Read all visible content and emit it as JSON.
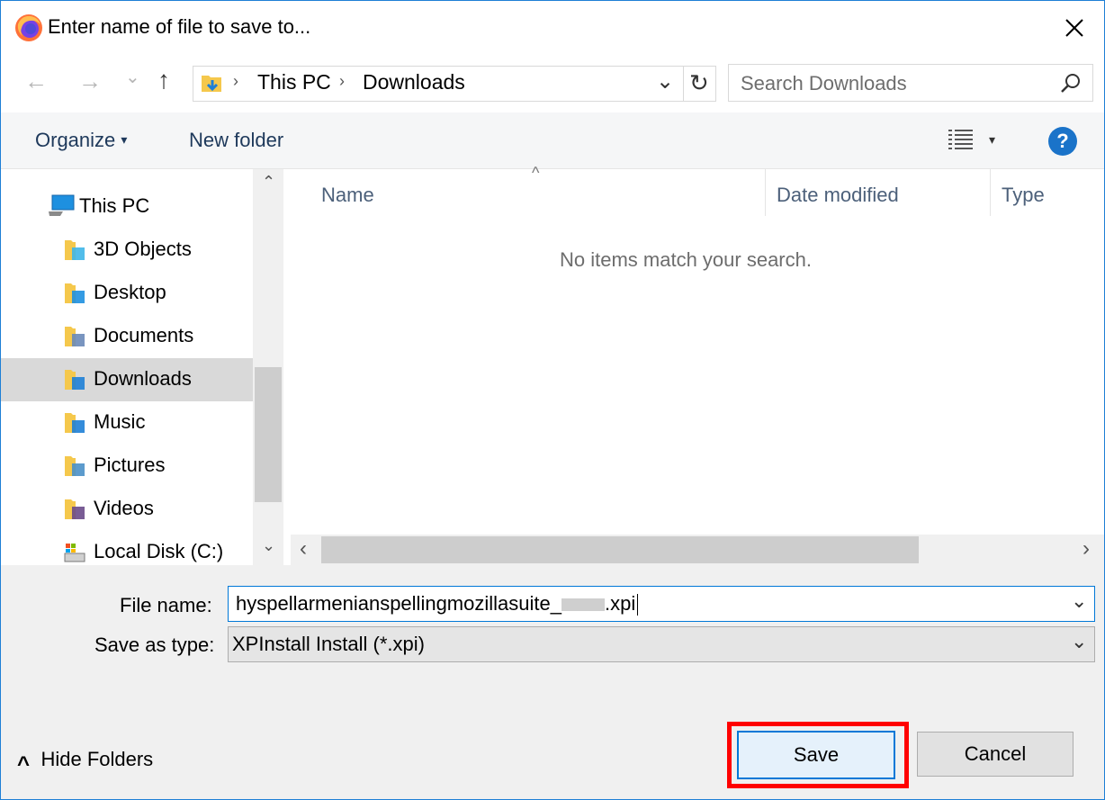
{
  "dialog": {
    "title": "Enter name of file to save to...",
    "close_glyph": "✕"
  },
  "address_bar": {
    "back_glyph": "←",
    "forward_glyph": "→",
    "recent_glyph": "⌄",
    "up_glyph": "↑",
    "crumb_sep": "›",
    "crumbs": [
      "This PC",
      "Downloads"
    ],
    "dropdown_glyph": "⌄",
    "refresh_glyph": "↻"
  },
  "search": {
    "placeholder": "Search Downloads",
    "icon": "search-icon"
  },
  "toolbar": {
    "organize_label": "Organize",
    "organize_caret": "▾",
    "new_folder_label": "New folder",
    "view_caret": "▾",
    "help_glyph": "?"
  },
  "nav_pane": {
    "root": "This PC",
    "items": [
      {
        "label": "3D Objects",
        "icon": "3d-objects-folder-icon"
      },
      {
        "label": "Desktop",
        "icon": "desktop-folder-icon"
      },
      {
        "label": "Documents",
        "icon": "documents-folder-icon"
      },
      {
        "label": "Downloads",
        "icon": "downloads-folder-icon",
        "selected": true
      },
      {
        "label": "Music",
        "icon": "music-folder-icon"
      },
      {
        "label": "Pictures",
        "icon": "pictures-folder-icon"
      },
      {
        "label": "Videos",
        "icon": "videos-folder-icon"
      },
      {
        "label": "Local Disk (C:)",
        "icon": "local-disk-icon"
      }
    ]
  },
  "file_list": {
    "sort_glyph": "^",
    "columns": [
      "Name",
      "Date modified",
      "Type"
    ],
    "empty_message": "No items match your search."
  },
  "scroll": {
    "up": "⌃",
    "down": "⌄",
    "left": "‹",
    "right": "›"
  },
  "form": {
    "file_name_label": "File name:",
    "file_name_value": "hyspellarmenianspellingmozillasuite_",
    "file_name_suffix": ".xpi",
    "save_as_type_label": "Save as type:",
    "save_as_type_value": "XPInstall Install (*.xpi)",
    "combo_caret": "⌄"
  },
  "footer": {
    "hide_folders_glyph": "^",
    "hide_folders_label": "Hide Folders",
    "save_label": "Save",
    "cancel_label": "Cancel"
  },
  "colors": {
    "accent": "#0078d7",
    "highlight": "#ff0000",
    "help_blue": "#1a73c9"
  }
}
